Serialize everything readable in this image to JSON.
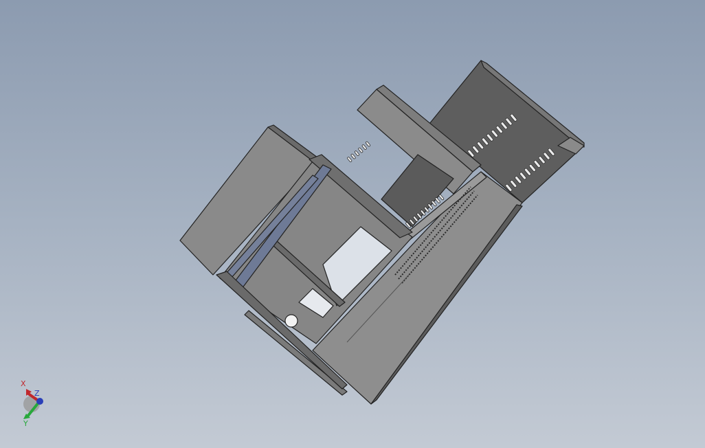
{
  "viewport": {
    "background_top": "#8c9bb0",
    "background_bottom": "#c3cad4"
  },
  "model": {
    "fill_light": "#8f8f8f",
    "fill_mid": "#7a7a7a",
    "fill_dark": "#5f5f5f",
    "edge": "#222222",
    "rail_accent": "#707c98"
  },
  "triad": {
    "x_label": "X",
    "y_label": "Y",
    "z_label": "Z",
    "x_color": "#c0282d",
    "y_color": "#28a83c",
    "z_color": "#2a3fb8"
  }
}
